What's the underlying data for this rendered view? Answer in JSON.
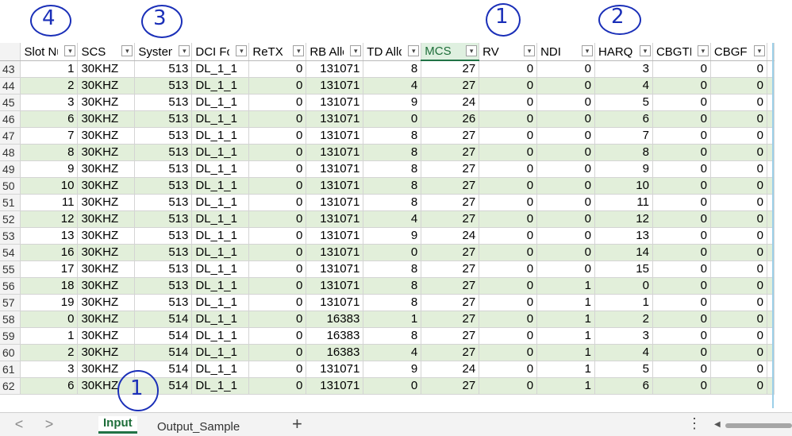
{
  "columns": [
    "Slot Nu",
    "SCS",
    "System",
    "DCI Forn",
    "ReTX In",
    "RB Allo",
    "TD Allo",
    "MCS",
    "RV",
    "NDI",
    "HARQ I",
    "CBGTI",
    "CBGFI"
  ],
  "rows": [
    {
      "n": "43",
      "c": [
        "1",
        "30KHZ",
        "513",
        "DL_1_1",
        "0",
        "131071",
        "8",
        "27",
        "0",
        "0",
        "3",
        "0",
        "0"
      ]
    },
    {
      "n": "44",
      "c": [
        "2",
        "30KHZ",
        "513",
        "DL_1_1",
        "0",
        "131071",
        "4",
        "27",
        "0",
        "0",
        "4",
        "0",
        "0"
      ]
    },
    {
      "n": "45",
      "c": [
        "3",
        "30KHZ",
        "513",
        "DL_1_1",
        "0",
        "131071",
        "9",
        "24",
        "0",
        "0",
        "5",
        "0",
        "0"
      ]
    },
    {
      "n": "46",
      "c": [
        "6",
        "30KHZ",
        "513",
        "DL_1_1",
        "0",
        "131071",
        "0",
        "26",
        "0",
        "0",
        "6",
        "0",
        "0"
      ]
    },
    {
      "n": "47",
      "c": [
        "7",
        "30KHZ",
        "513",
        "DL_1_1",
        "0",
        "131071",
        "8",
        "27",
        "0",
        "0",
        "7",
        "0",
        "0"
      ]
    },
    {
      "n": "48",
      "c": [
        "8",
        "30KHZ",
        "513",
        "DL_1_1",
        "0",
        "131071",
        "8",
        "27",
        "0",
        "0",
        "8",
        "0",
        "0"
      ]
    },
    {
      "n": "49",
      "c": [
        "9",
        "30KHZ",
        "513",
        "DL_1_1",
        "0",
        "131071",
        "8",
        "27",
        "0",
        "0",
        "9",
        "0",
        "0"
      ]
    },
    {
      "n": "50",
      "c": [
        "10",
        "30KHZ",
        "513",
        "DL_1_1",
        "0",
        "131071",
        "8",
        "27",
        "0",
        "0",
        "10",
        "0",
        "0"
      ]
    },
    {
      "n": "51",
      "c": [
        "11",
        "30KHZ",
        "513",
        "DL_1_1",
        "0",
        "131071",
        "8",
        "27",
        "0",
        "0",
        "11",
        "0",
        "0"
      ]
    },
    {
      "n": "52",
      "c": [
        "12",
        "30KHZ",
        "513",
        "DL_1_1",
        "0",
        "131071",
        "4",
        "27",
        "0",
        "0",
        "12",
        "0",
        "0"
      ]
    },
    {
      "n": "53",
      "c": [
        "13",
        "30KHZ",
        "513",
        "DL_1_1",
        "0",
        "131071",
        "9",
        "24",
        "0",
        "0",
        "13",
        "0",
        "0"
      ]
    },
    {
      "n": "54",
      "c": [
        "16",
        "30KHZ",
        "513",
        "DL_1_1",
        "0",
        "131071",
        "0",
        "27",
        "0",
        "0",
        "14",
        "0",
        "0"
      ]
    },
    {
      "n": "55",
      "c": [
        "17",
        "30KHZ",
        "513",
        "DL_1_1",
        "0",
        "131071",
        "8",
        "27",
        "0",
        "0",
        "15",
        "0",
        "0"
      ]
    },
    {
      "n": "56",
      "c": [
        "18",
        "30KHZ",
        "513",
        "DL_1_1",
        "0",
        "131071",
        "8",
        "27",
        "0",
        "1",
        "0",
        "0",
        "0"
      ]
    },
    {
      "n": "57",
      "c": [
        "19",
        "30KHZ",
        "513",
        "DL_1_1",
        "0",
        "131071",
        "8",
        "27",
        "0",
        "1",
        "1",
        "0",
        "0"
      ]
    },
    {
      "n": "58",
      "c": [
        "0",
        "30KHZ",
        "514",
        "DL_1_1",
        "0",
        "16383",
        "1",
        "27",
        "0",
        "1",
        "2",
        "0",
        "0"
      ]
    },
    {
      "n": "59",
      "c": [
        "1",
        "30KHZ",
        "514",
        "DL_1_1",
        "0",
        "16383",
        "8",
        "27",
        "0",
        "1",
        "3",
        "0",
        "0"
      ]
    },
    {
      "n": "60",
      "c": [
        "2",
        "30KHZ",
        "514",
        "DL_1_1",
        "0",
        "16383",
        "4",
        "27",
        "0",
        "1",
        "4",
        "0",
        "0"
      ]
    },
    {
      "n": "61",
      "c": [
        "3",
        "30KHZ",
        "514",
        "DL_1_1",
        "0",
        "131071",
        "9",
        "24",
        "0",
        "1",
        "5",
        "0",
        "0"
      ]
    },
    {
      "n": "62",
      "c": [
        "6",
        "30KHZ",
        "514",
        "DL_1_1",
        "0",
        "131071",
        "0",
        "27",
        "0",
        "1",
        "6",
        "0",
        "0"
      ]
    }
  ],
  "tabs": {
    "prev": "<",
    "next": ">",
    "active": "Input",
    "other": "Output_Sample",
    "add": "+",
    "more": "⋮"
  },
  "annotations": {
    "a1": "1",
    "a2": "2",
    "a3": "3",
    "a4": "4",
    "a5": "1"
  },
  "icons": {
    "filter": "filter-dropdown-icon"
  },
  "colors": {
    "band": "#e2efda",
    "accent": "#217346",
    "ink": "#1a2fb8"
  }
}
